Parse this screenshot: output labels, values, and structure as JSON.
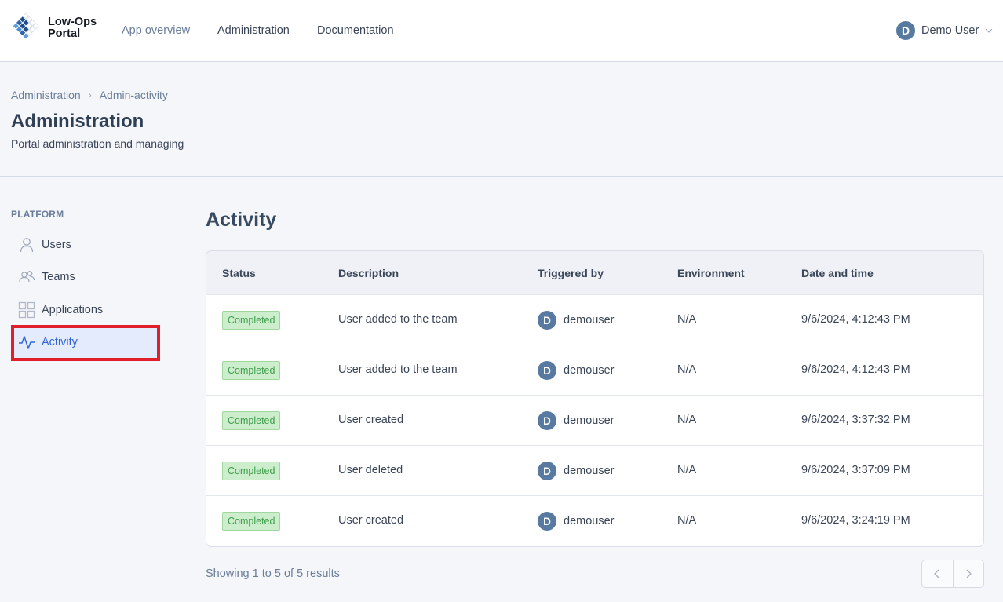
{
  "app": {
    "logo_line1": "Low-Ops",
    "logo_line2": "Portal"
  },
  "nav": {
    "items": [
      {
        "label": "App overview"
      },
      {
        "label": "Administration"
      },
      {
        "label": "Documentation"
      }
    ]
  },
  "user": {
    "initial": "D",
    "name": "Demo User"
  },
  "breadcrumb": {
    "items": [
      "Administration",
      "Admin-activity"
    ],
    "separator": "›"
  },
  "header": {
    "title": "Administration",
    "subtitle": "Portal administration and managing"
  },
  "sidebar": {
    "heading": "PLATFORM",
    "items": [
      {
        "label": "Users",
        "icon": "user-icon"
      },
      {
        "label": "Teams",
        "icon": "team-icon"
      },
      {
        "label": "Applications",
        "icon": "grid-icon"
      },
      {
        "label": "Activity",
        "icon": "activity-icon",
        "active": true
      }
    ]
  },
  "main": {
    "title": "Activity",
    "columns": [
      "Status",
      "Description",
      "Triggered by",
      "Environment",
      "Date and time"
    ],
    "rows": [
      {
        "status": "Completed",
        "description": "User added to the team",
        "user_initial": "D",
        "user": "demouser",
        "environment": "N/A",
        "datetime": "9/6/2024, 4:12:43 PM"
      },
      {
        "status": "Completed",
        "description": "User added to the team",
        "user_initial": "D",
        "user": "demouser",
        "environment": "N/A",
        "datetime": "9/6/2024, 4:12:43 PM"
      },
      {
        "status": "Completed",
        "description": "User created",
        "user_initial": "D",
        "user": "demouser",
        "environment": "N/A",
        "datetime": "9/6/2024, 3:37:32 PM"
      },
      {
        "status": "Completed",
        "description": "User deleted",
        "user_initial": "D",
        "user": "demouser",
        "environment": "N/A",
        "datetime": "9/6/2024, 3:37:09 PM"
      },
      {
        "status": "Completed",
        "description": "User created",
        "user_initial": "D",
        "user": "demouser",
        "environment": "N/A",
        "datetime": "9/6/2024, 3:24:19 PM"
      }
    ],
    "results_text": "Showing 1 to 5 of 5 results"
  },
  "colors": {
    "accent": "#3166d6",
    "status_completed": "#3f9d4a",
    "highlight": "#e01f2a"
  }
}
